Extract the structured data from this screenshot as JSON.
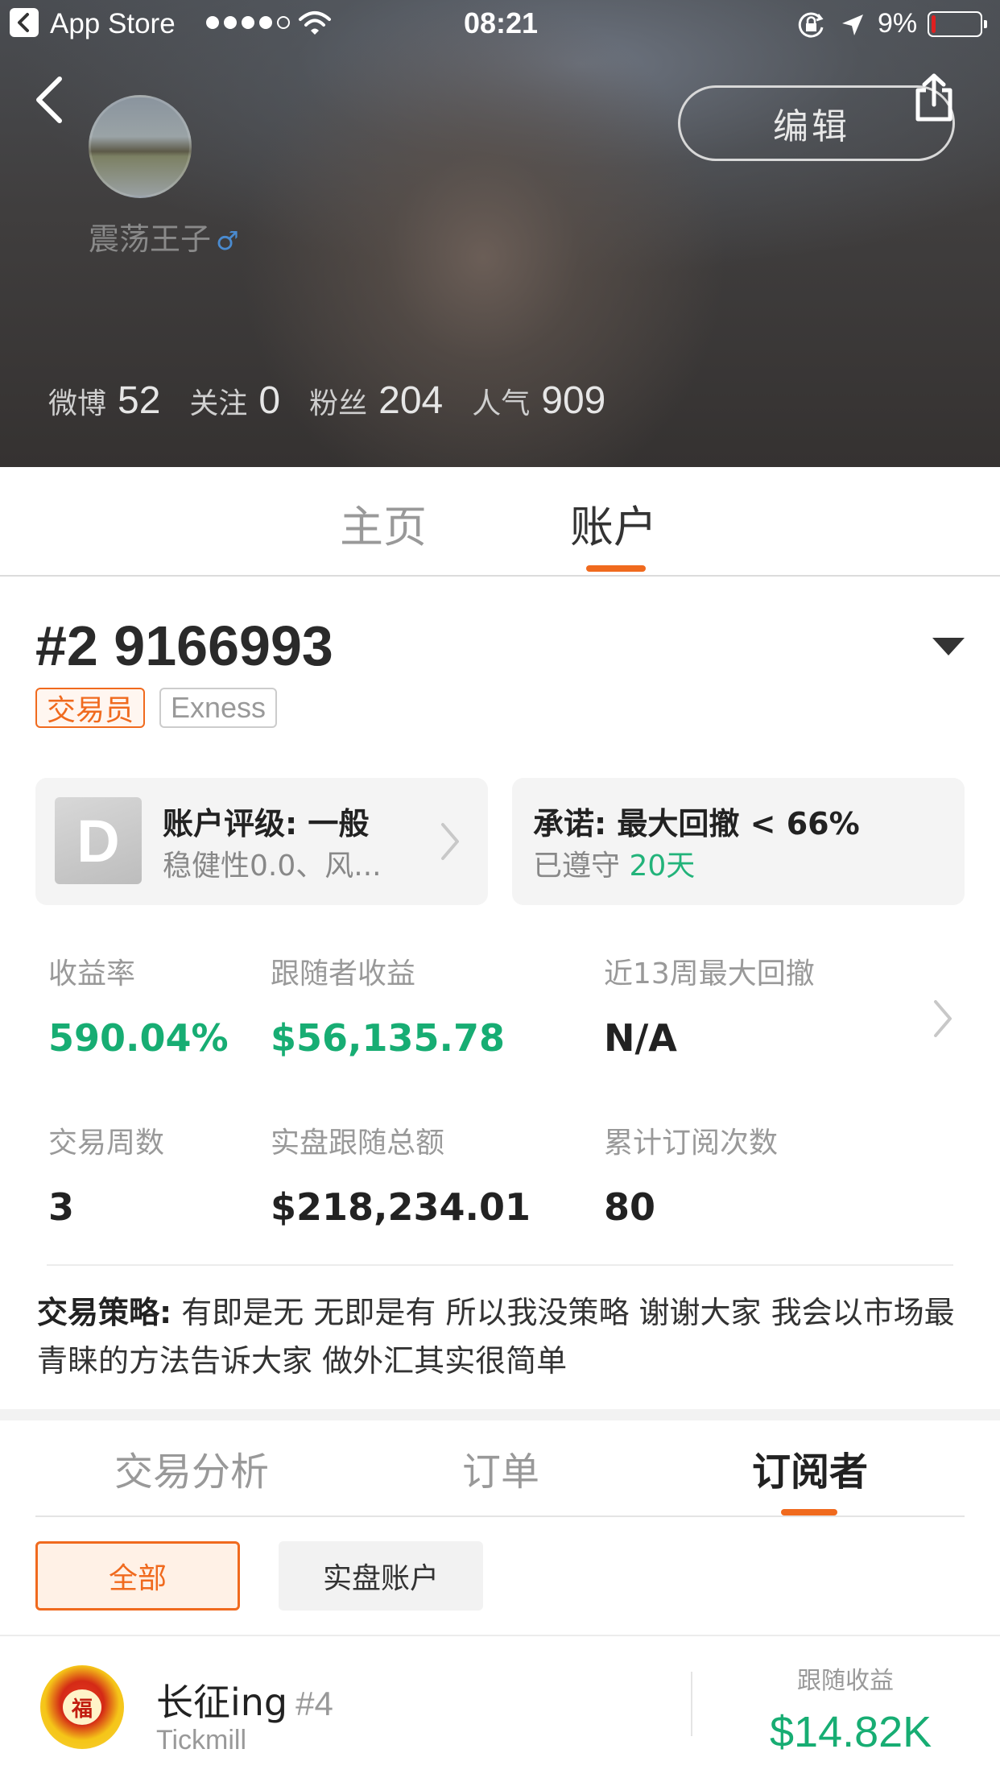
{
  "status_bar": {
    "back_app": "App Store",
    "time": "08:21",
    "battery_percent_text": "9%",
    "battery_level": 0.09,
    "signal_bars": 4,
    "signal_total": 5
  },
  "header": {
    "edit_label": "编辑",
    "username": "震荡王子",
    "gender_symbol": "♂",
    "stats": [
      {
        "label": "微博",
        "value": "52"
      },
      {
        "label": "关注",
        "value": "0"
      },
      {
        "label": "粉丝",
        "value": "204"
      },
      {
        "label": "人气",
        "value": "909"
      }
    ]
  },
  "main_tabs": [
    {
      "label": "主页",
      "active": false
    },
    {
      "label": "账户",
      "active": true
    }
  ],
  "account": {
    "number": "#2 9166993",
    "tags": [
      "交易员",
      "Exness"
    ],
    "rating_card": {
      "grade": "D",
      "title": "账户评级: 一般",
      "subtitle": "稳健性0.0、风..."
    },
    "promise_card": {
      "title": "承诺: 最大回撤 < 66%",
      "kept_label": "已遵守",
      "days": "20天"
    },
    "metrics": [
      {
        "label": "收益率",
        "value": "590.04%"
      },
      {
        "label": "跟随者收益",
        "value": "$56,135.78"
      },
      {
        "label": "近13周最大回撤",
        "value": "N/A"
      },
      {
        "label": "交易周数",
        "value": "3"
      },
      {
        "label": "实盘跟随总额",
        "value": "$218,234.01"
      },
      {
        "label": "累计订阅次数",
        "value": "80"
      }
    ],
    "strategy": {
      "label": "交易策略:",
      "text": "有即是无 无即是有 所以我没策略 谢谢大家 我会以市场最青睐的方法告诉大家 做外汇其实很简单"
    }
  },
  "sub_tabs": [
    {
      "label": "交易分析",
      "active": false
    },
    {
      "label": "订单",
      "active": false
    },
    {
      "label": "订阅者",
      "active": true
    }
  ],
  "filters": [
    {
      "label": "全部",
      "active": true
    },
    {
      "label": "实盘账户",
      "active": false
    }
  ],
  "subscribers": [
    {
      "name": "长征ing",
      "rank": "#4",
      "broker": "Tickmill",
      "return_label": "跟随收益",
      "return_value": "$14.82K"
    }
  ],
  "colors": {
    "accent": "#f06a1e",
    "positive": "#17ad73",
    "days": "#22b37a"
  },
  "icons": {
    "back": "chevron-left-icon",
    "share": "share-icon",
    "dropdown": "triangle-down-icon",
    "chevron": "chevron-right-icon",
    "wifi": "wifi-icon",
    "rotation_lock": "rotation-lock-icon",
    "location": "location-arrow-icon",
    "battery": "battery-icon"
  }
}
